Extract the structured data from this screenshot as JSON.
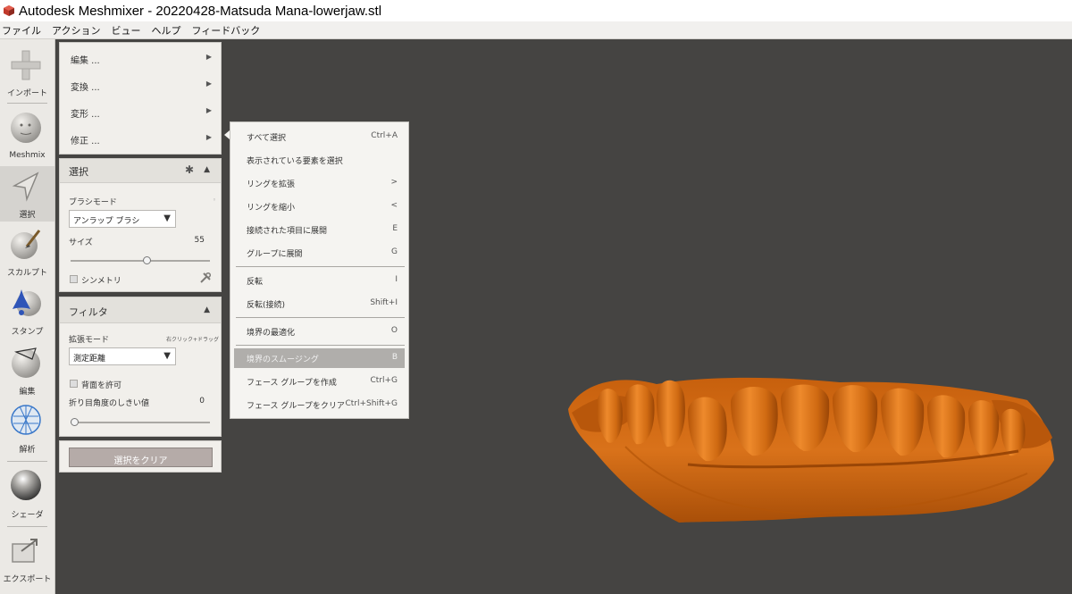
{
  "window": {
    "title": "Autodesk Meshmixer - 20220428-Matsuda Mana-lowerjaw.stl"
  },
  "menubar": {
    "items": [
      "ファイル",
      "アクション",
      "ビュー",
      "ヘルプ",
      "フィードバック"
    ]
  },
  "toolbar": {
    "items": [
      {
        "label": "インポート",
        "icon": "plus-icon"
      },
      {
        "label": "Meshmix",
        "icon": "face-sphere-icon"
      },
      {
        "label": "選択",
        "icon": "arrow-cursor-icon"
      },
      {
        "label": "スカルプト",
        "icon": "brush-sphere-icon"
      },
      {
        "label": "スタンプ",
        "icon": "stamp-sphere-icon"
      },
      {
        "label": "編集",
        "icon": "edit-sphere-icon"
      },
      {
        "label": "解析",
        "icon": "analysis-mesh-icon"
      },
      {
        "label": "シェーダ",
        "icon": "shader-sphere-icon"
      },
      {
        "label": "エクスポート",
        "icon": "export-icon"
      }
    ]
  },
  "side_menu": {
    "items": [
      "編集 ...",
      "変換 ...",
      "変形 ...",
      "修正 ..."
    ]
  },
  "select_panel": {
    "title": "選択",
    "brush_mode_label": "ブラシモード",
    "brush_mode_value": "アンラップ ブラシ",
    "size_label": "サイズ",
    "size_value": "55",
    "size_fraction": 0.55,
    "symmetry_label": "シンメトリ"
  },
  "filter_panel": {
    "title": "フィルタ",
    "expand_mode_label": "拡張モード",
    "expand_mode_hint": "右クリック+ドラッグ",
    "expand_mode_value": "測定距離",
    "backface_label": "背面を許可",
    "crease_label": "折り目角度のしきい値",
    "crease_value": "0",
    "crease_fraction": 0
  },
  "clear_button": {
    "label": "選択をクリア"
  },
  "context_menu": {
    "groups": [
      [
        {
          "label": "すべて選択",
          "key": "Ctrl+A"
        },
        {
          "label": "表示されている要素を選択",
          "key": ""
        },
        {
          "label": "リングを拡張",
          "key": ">"
        },
        {
          "label": "リングを縮小",
          "key": "<"
        },
        {
          "label": "接続された項目に展開",
          "key": "E"
        },
        {
          "label": "グループに展開",
          "key": "G"
        }
      ],
      [
        {
          "label": "反転",
          "key": "I"
        },
        {
          "label": "反転(接続)",
          "key": "Shift+I"
        }
      ],
      [
        {
          "label": "境界の最適化",
          "key": "O"
        }
      ],
      [
        {
          "label": "境界のスムージング",
          "key": "B",
          "highlighted": true
        },
        {
          "label": "フェース グループを作成",
          "key": "Ctrl+G"
        },
        {
          "label": "フェース グループをクリア",
          "key": "Ctrl+Shift+G"
        }
      ]
    ]
  },
  "viewport": {
    "model_color": "#d96f14",
    "background_color": "#454442"
  }
}
